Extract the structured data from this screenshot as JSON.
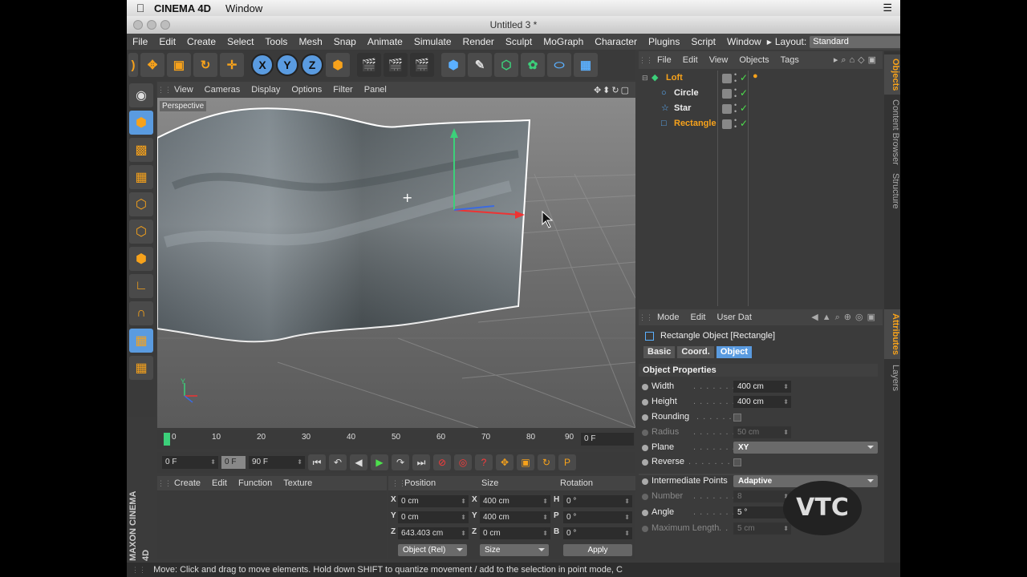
{
  "mac_menubar": {
    "app_name": "CINEMA 4D",
    "window_menu": "Window",
    "apple_icon": "apple-icon",
    "list_icon": "☰"
  },
  "window": {
    "title": "Untitled 3 *"
  },
  "menubar": {
    "items": [
      "File",
      "Edit",
      "Create",
      "Select",
      "Tools",
      "Mesh",
      "Snap",
      "Animate",
      "Simulate",
      "Render",
      "Sculpt",
      "MoGraph",
      "Character",
      "Plugins",
      "Script",
      "Window"
    ],
    "layout_label": "Layout:",
    "layout_value": "Standard"
  },
  "toolbar": {
    "axis_buttons": [
      "X",
      "Y",
      "Z"
    ]
  },
  "viewport": {
    "menu": [
      "View",
      "Cameras",
      "Display",
      "Options",
      "Filter",
      "Panel"
    ],
    "label": "Perspective",
    "axis_y": "Y"
  },
  "timeline": {
    "ticks": [
      "0",
      "10",
      "20",
      "30",
      "40",
      "50",
      "60",
      "70",
      "80",
      "90"
    ],
    "current_frame": "0 F",
    "start_frame": "0 F",
    "end_frame": "90 F",
    "preview_min": "0 F"
  },
  "material_panel": {
    "menu": [
      "Create",
      "Edit",
      "Function",
      "Texture"
    ]
  },
  "coord_panel": {
    "headers": {
      "position": "Position",
      "size": "Size",
      "rotation": "Rotation"
    },
    "rows": [
      {
        "ax1": "X",
        "pos": "0 cm",
        "ax2": "X",
        "size": "400 cm",
        "ax3": "H",
        "rot": "0 °"
      },
      {
        "ax1": "Y",
        "pos": "0 cm",
        "ax2": "Y",
        "size": "400 cm",
        "ax3": "P",
        "rot": "0 °"
      },
      {
        "ax1": "Z",
        "pos": "643.403 cm",
        "ax2": "Z",
        "size": "0 cm",
        "ax3": "B",
        "rot": "0 °"
      }
    ],
    "mode_select": "Object (Rel)",
    "size_select": "Size",
    "apply": "Apply"
  },
  "status_bar": {
    "text": "Move: Click and drag to move elements. Hold down SHIFT to quantize movement / add to the selection in point mode, C"
  },
  "object_manager": {
    "menu": [
      "File",
      "Edit",
      "View",
      "Objects",
      "Tags"
    ],
    "objects": [
      {
        "name": "Loft",
        "level": 0,
        "color": "#f7a21b"
      },
      {
        "name": "Circle",
        "level": 1,
        "color": "#eeeeee"
      },
      {
        "name": "Star",
        "level": 1,
        "color": "#eeeeee"
      },
      {
        "name": "Rectangle",
        "level": 1,
        "color": "#f7a21b"
      }
    ]
  },
  "right_tabs": {
    "objects": "Objects",
    "content_browser": "Content Browser",
    "structure": "Structure",
    "attributes": "Attributes",
    "layers": "Layers"
  },
  "attribute_manager": {
    "menu": [
      "Mode",
      "Edit",
      "User Dat"
    ],
    "title": "Rectangle Object [Rectangle]",
    "tabs": [
      "Basic",
      "Coord.",
      "Object"
    ],
    "active_tab": "Object",
    "section": "Object Properties",
    "props": {
      "width": {
        "label": "Width",
        "value": "400 cm"
      },
      "height": {
        "label": "Height",
        "value": "400 cm"
      },
      "rounding": {
        "label": "Rounding"
      },
      "radius": {
        "label": "Radius",
        "value": "50 cm"
      },
      "plane": {
        "label": "Plane",
        "value": "XY"
      },
      "reverse": {
        "label": "Reverse"
      },
      "intermediate": {
        "label": "Intermediate Points",
        "value": "Adaptive"
      },
      "number": {
        "label": "Number",
        "value": "8"
      },
      "angle": {
        "label": "Angle",
        "value": "5 °"
      },
      "max_length": {
        "label": "Maximum Length",
        "value": "5 cm"
      }
    }
  },
  "maxon_brand": "MAXON CINEMA 4D",
  "watermark": "VTC",
  "colors": {
    "accent": "#f7a21b",
    "selection": "#5a9be0",
    "panel": "#3b3b3b"
  }
}
